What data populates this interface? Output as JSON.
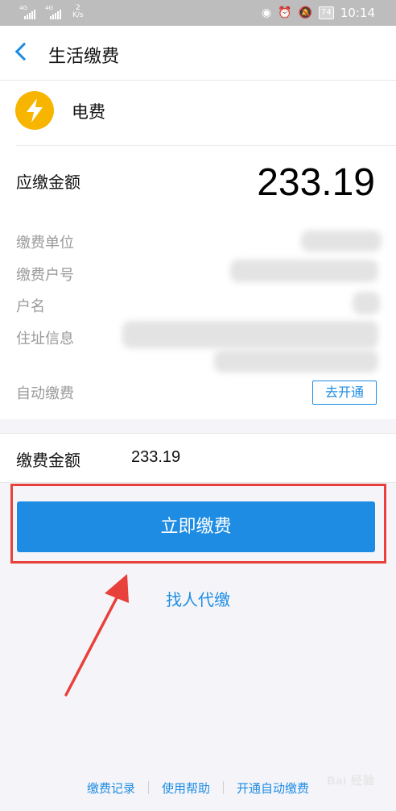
{
  "status_bar": {
    "signal1_net": "4G",
    "signal2_net": "4G",
    "speed_value": "2",
    "speed_unit": "K/s",
    "battery": "74",
    "time": "10:14"
  },
  "header": {
    "title": "生活缴费"
  },
  "bill": {
    "type_name": "电费",
    "due_label": "应缴金额",
    "due_amount": "233.19",
    "fields": [
      {
        "label": "缴费单位"
      },
      {
        "label": "缴费户号"
      },
      {
        "label": "户名"
      },
      {
        "label": "住址信息"
      }
    ],
    "autopay_label": "自动缴费",
    "autopay_button": "去开通"
  },
  "payment": {
    "amount_label": "缴费金额",
    "amount_value": "233.19",
    "pay_button": "立即缴费",
    "proxy_link": "找人代缴"
  },
  "footer": {
    "links": [
      "缴费记录",
      "使用帮助",
      "开通自动缴费"
    ]
  },
  "watermark": "Bai 经验",
  "colors": {
    "accent": "#1e8ce3",
    "highlight": "#e8413b",
    "electric_icon": "#f7b500"
  }
}
